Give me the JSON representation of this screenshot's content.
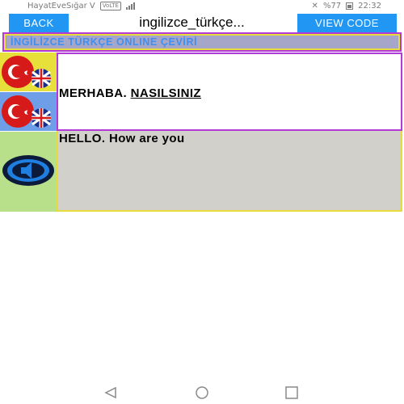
{
  "status_bar": {
    "carrier": "HayatEveSığar V",
    "network_badge": "VoLTE",
    "battery_percent": "%77",
    "time": "22:32"
  },
  "toolbar": {
    "back_label": "BACK",
    "title": "ingilizce_türkçe...",
    "view_code_label": "VIEW CODE"
  },
  "header": {
    "title": "İNGİLİZCE TÜRKÇE ONLINE ÇEVİRİ"
  },
  "translator": {
    "input_text_plain": "MERHABA. ",
    "input_text_underlined": "NASILSINIZ",
    "output_text": "HELLO. How are you"
  },
  "colors": {
    "button_blue": "#2196f3",
    "header_bg": "#a6a6c8",
    "header_text": "#3f8ff0",
    "border_purple": "#b33ad6",
    "border_yellow": "#e8dc3c",
    "output_bg": "#d2d0cb",
    "speaker_area_bg": "#b8e08a"
  },
  "icons": {
    "flag_button_one": "turkey-uk-flag-icon",
    "flag_button_two": "turkey-uk-flag-icon",
    "speaker": "speaker-icon",
    "nav_back": "triangle-back-icon",
    "nav_home": "circle-home-icon",
    "nav_recents": "square-recents-icon"
  }
}
